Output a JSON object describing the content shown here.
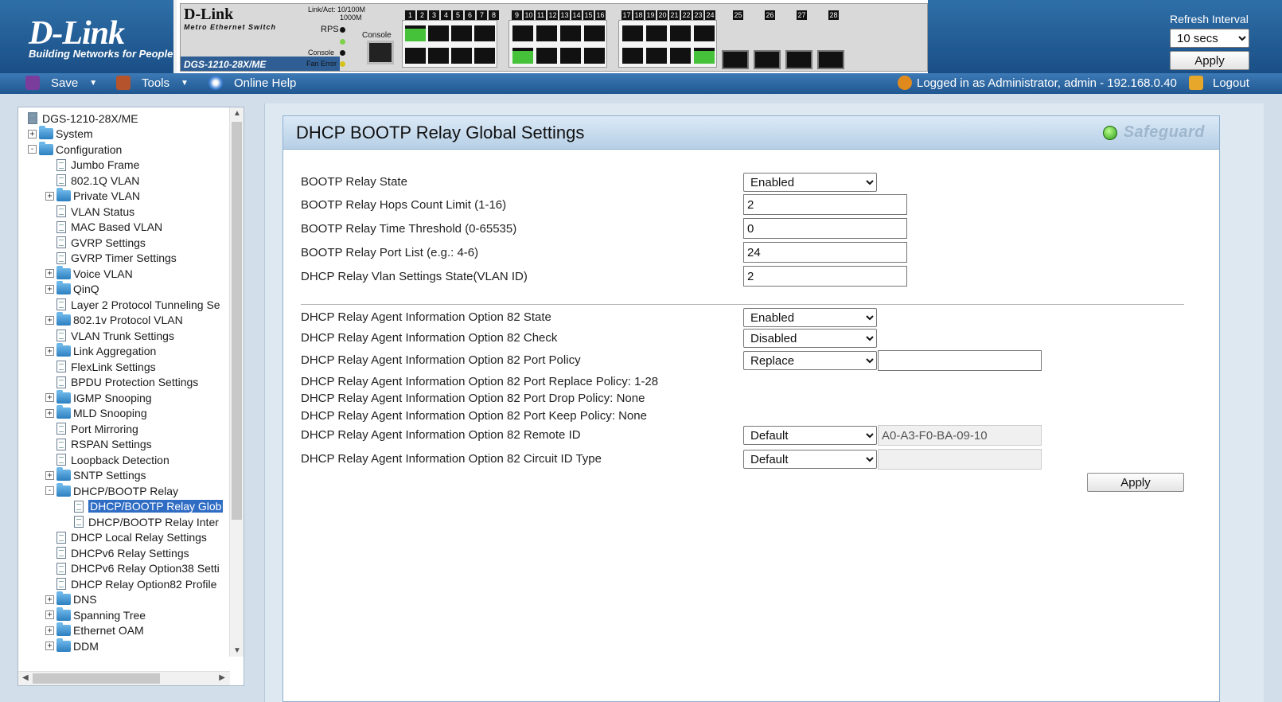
{
  "header": {
    "logo": "D-Link",
    "logo_tagline": "Building Networks for People",
    "device_brand": "D-Link",
    "device_subtitle": "Metro Ethernet Switch",
    "device_model": "DGS-1210-28X/ME",
    "led_labels": [
      "Link/Act: 10/100M",
      "1000M",
      "RPS",
      "Console",
      "Fan Error",
      "Console"
    ],
    "port_numbers": [
      "1",
      "2",
      "3",
      "4",
      "5",
      "6",
      "7",
      "8",
      "9",
      "10",
      "11",
      "12",
      "13",
      "14",
      "15",
      "16",
      "17",
      "18",
      "19",
      "20",
      "21",
      "22",
      "23",
      "24",
      "25",
      "26",
      "27",
      "28"
    ],
    "refresh_label": "Refresh Interval",
    "refresh_value": "10 secs",
    "refresh_options": [
      "10 secs"
    ],
    "apply_label": "Apply"
  },
  "toolbar": {
    "save_label": "Save",
    "tools_label": "Tools",
    "help_label": "Online Help",
    "login_text": "Logged in as Administrator, admin - 192.168.0.40",
    "logout_label": "Logout"
  },
  "tree": {
    "nodes": [
      {
        "label": "DGS-1210-28X/ME",
        "level": 0,
        "kind": "root"
      },
      {
        "label": "System",
        "level": 0,
        "kind": "folder",
        "expander": "+"
      },
      {
        "label": "Configuration",
        "level": 0,
        "kind": "folder-open",
        "expander": "-"
      },
      {
        "label": "Jumbo Frame",
        "level": 1,
        "kind": "page"
      },
      {
        "label": "802.1Q VLAN",
        "level": 1,
        "kind": "page"
      },
      {
        "label": "Private VLAN",
        "level": 1,
        "kind": "folder",
        "expander": "+"
      },
      {
        "label": "VLAN Status",
        "level": 1,
        "kind": "page"
      },
      {
        "label": "MAC Based VLAN",
        "level": 1,
        "kind": "page"
      },
      {
        "label": "GVRP Settings",
        "level": 1,
        "kind": "page"
      },
      {
        "label": "GVRP Timer Settings",
        "level": 1,
        "kind": "page"
      },
      {
        "label": "Voice VLAN",
        "level": 1,
        "kind": "folder",
        "expander": "+"
      },
      {
        "label": "QinQ",
        "level": 1,
        "kind": "folder",
        "expander": "+"
      },
      {
        "label": "Layer 2 Protocol Tunneling Se",
        "level": 1,
        "kind": "page"
      },
      {
        "label": "802.1v Protocol VLAN",
        "level": 1,
        "kind": "folder",
        "expander": "+"
      },
      {
        "label": "VLAN Trunk Settings",
        "level": 1,
        "kind": "page"
      },
      {
        "label": "Link Aggregation",
        "level": 1,
        "kind": "folder",
        "expander": "+"
      },
      {
        "label": "FlexLink Settings",
        "level": 1,
        "kind": "page"
      },
      {
        "label": "BPDU Protection Settings",
        "level": 1,
        "kind": "page"
      },
      {
        "label": "IGMP Snooping",
        "level": 1,
        "kind": "folder",
        "expander": "+"
      },
      {
        "label": "MLD Snooping",
        "level": 1,
        "kind": "folder",
        "expander": "+"
      },
      {
        "label": "Port Mirroring",
        "level": 1,
        "kind": "page"
      },
      {
        "label": "RSPAN Settings",
        "level": 1,
        "kind": "page"
      },
      {
        "label": "Loopback Detection",
        "level": 1,
        "kind": "page"
      },
      {
        "label": "SNTP Settings",
        "level": 1,
        "kind": "folder",
        "expander": "+"
      },
      {
        "label": "DHCP/BOOTP Relay",
        "level": 1,
        "kind": "folder-open",
        "expander": "-"
      },
      {
        "label": "DHCP/BOOTP Relay Glob",
        "level": 2,
        "kind": "page",
        "selected": true
      },
      {
        "label": "DHCP/BOOTP Relay Inter",
        "level": 2,
        "kind": "page"
      },
      {
        "label": "DHCP Local Relay Settings",
        "level": 1,
        "kind": "page"
      },
      {
        "label": "DHCPv6 Relay Settings",
        "level": 1,
        "kind": "page"
      },
      {
        "label": "DHCPv6 Relay Option38 Setti",
        "level": 1,
        "kind": "page"
      },
      {
        "label": "DHCP Relay Option82 Profile",
        "level": 1,
        "kind": "page"
      },
      {
        "label": "DNS",
        "level": 1,
        "kind": "folder",
        "expander": "+"
      },
      {
        "label": "Spanning Tree",
        "level": 1,
        "kind": "folder",
        "expander": "+"
      },
      {
        "label": "Ethernet OAM",
        "level": 1,
        "kind": "folder",
        "expander": "+"
      },
      {
        "label": "DDM",
        "level": 1,
        "kind": "folder",
        "expander": "+"
      }
    ]
  },
  "main": {
    "title": "DHCP BOOTP Relay Global Settings",
    "safeguard_label": "Safeguard",
    "bootp_state_label": "BOOTP Relay State",
    "bootp_state_value": "Enabled",
    "hops_label": "BOOTP Relay Hops Count Limit (1-16)",
    "hops_value": "2",
    "time_label": "BOOTP Relay Time Threshold (0-65535)",
    "time_value": "0",
    "portlist_label": "BOOTP Relay Port List (e.g.: 4-6)",
    "portlist_value": "24",
    "vlan_label": "DHCP Relay Vlan Settings State(VLAN ID)",
    "vlan_value": "2",
    "opt82_state_label": "DHCP Relay Agent Information Option 82 State",
    "opt82_state_value": "Enabled",
    "opt82_check_label": "DHCP Relay Agent Information Option 82 Check",
    "opt82_check_value": "Disabled",
    "opt82_policy_label": "DHCP Relay Agent Information Option 82 Port Policy",
    "opt82_policy_value": "Replace",
    "opt82_policy_ports": "",
    "replace_policy_text": "DHCP Relay Agent Information Option 82 Port Replace Policy: 1-28",
    "drop_policy_text": "DHCP Relay Agent Information Option 82 Port Drop Policy: None",
    "keep_policy_text": "DHCP Relay Agent Information Option 82 Port Keep Policy: None",
    "remote_id_label": "DHCP Relay Agent Information Option 82 Remote ID",
    "remote_id_type": "Default",
    "remote_id_value": "A0-A3-F0-BA-09-10",
    "circuit_id_label": "DHCP Relay Agent Information Option 82 Circuit ID Type",
    "circuit_id_type": "Default",
    "circuit_id_value": "",
    "apply_label": "Apply"
  },
  "colors": {
    "brand_blue": "#1a4f86",
    "toolbar_blue": "#2b679f",
    "selected_blue": "#2f6cc4",
    "port_link_green": "#46c23a"
  }
}
